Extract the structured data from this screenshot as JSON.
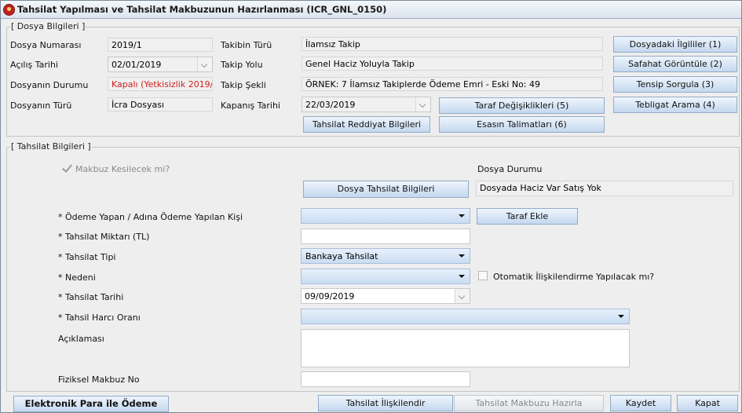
{
  "window": {
    "title": "Tahsilat Yapılması ve Tahsilat Makbuzunun Hazırlanması (ICR_GNL_0150)"
  },
  "dosya": {
    "group_label": "[ Dosya Bilgileri ]",
    "numara_label": "Dosya Numarası",
    "numara_value": "2019/1",
    "acilis_label": "Açılış Tarihi",
    "acilis_value": "02/01/2019",
    "durum_label": "Dosyanın Durumu",
    "durum_value": "Kapalı (Yetkisizlik 2019/1",
    "turu_label": "Dosyanın Türü",
    "turu_value": "İcra Dosyası",
    "takip_turu_label": "Takibin Türü",
    "takip_turu_value": "İlamsız Takip",
    "takip_yolu_label": "Takip Yolu",
    "takip_yolu_value": "Genel Haciz Yoluyla Takip",
    "takip_sekli_label": "Takip Şekli",
    "takip_sekli_value": "ÖRNEK: 7 İlamsız Takiplerde Ödeme Emri - Eski No: 49",
    "kapanis_label": "Kapanış Tarihi",
    "kapanis_value": "22/03/2019",
    "buttons": {
      "ilgililer": "Dosyadaki İlgililer (1)",
      "safahat": "Safahat Görüntüle (2)",
      "tensip": "Tensip Sorgula (3)",
      "tebligat": "Tebligat Arama (4)",
      "taraf_degisiklikleri": "Taraf Değişiklikleri (5)",
      "esasin_talimatlari": "Esasın Talimatları (6)",
      "tahsilat_reddiyat": "Tahsilat Reddiyat Bilgileri"
    }
  },
  "tahsilat": {
    "group_label": "[ Tahsilat Bilgileri ]",
    "makbuz_label": "Makbuz Kesilecek mi?",
    "dosya_durumu_label": "Dosya Durumu",
    "dosya_durumu_value": "Dosyada Haciz Var Satış Yok",
    "dosya_tahsilat_button": "Dosya Tahsilat Bilgileri",
    "odeme_yapan_label": "* Ödeme Yapan / Adına Ödeme Yapılan Kişi",
    "odeme_yapan_value": "",
    "taraf_ekle_button": "Taraf Ekle",
    "miktar_label": "* Tahsilat Miktarı (TL)",
    "miktar_value": "",
    "tipi_label": "* Tahsilat Tipi",
    "tipi_value": "Bankaya Tahsilat",
    "nedeni_label": "* Nedeni",
    "nedeni_value": "",
    "otomatik_label": "Otomatik İlişkilendirme Yapılacak mı?",
    "tarih_label": "* Tahsilat Tarihi",
    "tarih_value": "09/09/2019",
    "harc_label": "* Tahsil Harcı Oranı",
    "harc_value": "",
    "aciklama_label": "Açıklaması",
    "fiziksel_label": "Fiziksel Makbuz No",
    "fiziksel_value": ""
  },
  "footer": {
    "elektronik": "Elektronik Para ile Ödeme",
    "iliskilendir": "Tahsilat İlişkilendir",
    "makbuz_hazirla": "Tahsilat Makbuzu Hazırla",
    "kaydet": "Kaydet",
    "kapat": "Kapat"
  }
}
